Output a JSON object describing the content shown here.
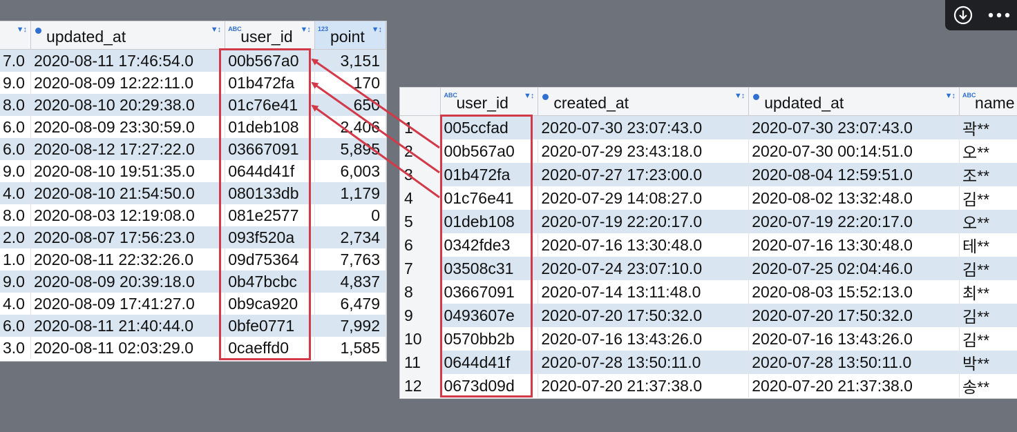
{
  "toolbar": {
    "download_icon": "download-circle-icon",
    "more_icon": "ellipsis-icon"
  },
  "left_grid": {
    "columns": [
      {
        "label": "",
        "type_badge": "",
        "filter": "▼↕"
      },
      {
        "label": "updated_at",
        "type_badge": "●",
        "filter": "▼↕"
      },
      {
        "label": "user_id",
        "type_badge": "ABC",
        "filter": "▼↕"
      },
      {
        "label": "point",
        "type_badge": "123",
        "filter": "▼↕"
      }
    ],
    "rows": [
      {
        "frag": "7.0",
        "updated_at": "2020-08-11 17:46:54.0",
        "user_id": "00b567a0",
        "point": "3,151"
      },
      {
        "frag": "9.0",
        "updated_at": "2020-08-09 12:22:11.0",
        "user_id": "01b472fa",
        "point": "170"
      },
      {
        "frag": "8.0",
        "updated_at": "2020-08-10 20:29:38.0",
        "user_id": "01c76e41",
        "point": "650"
      },
      {
        "frag": "6.0",
        "updated_at": "2020-08-09 23:30:59.0",
        "user_id": "01deb108",
        "point": "2,406"
      },
      {
        "frag": "6.0",
        "updated_at": "2020-08-12 17:27:22.0",
        "user_id": "03667091",
        "point": "5,895"
      },
      {
        "frag": "9.0",
        "updated_at": "2020-08-10 19:51:35.0",
        "user_id": "0644d41f",
        "point": "6,003"
      },
      {
        "frag": "4.0",
        "updated_at": "2020-08-10 21:54:50.0",
        "user_id": "080133db",
        "point": "1,179"
      },
      {
        "frag": "8.0",
        "updated_at": "2020-08-03 12:19:08.0",
        "user_id": "081e2577",
        "point": "0"
      },
      {
        "frag": "2.0",
        "updated_at": "2020-08-07 17:56:23.0",
        "user_id": "093f520a",
        "point": "2,734"
      },
      {
        "frag": "1.0",
        "updated_at": "2020-08-11 22:32:26.0",
        "user_id": "09d75364",
        "point": "7,763"
      },
      {
        "frag": "9.0",
        "updated_at": "2020-08-09 20:39:18.0",
        "user_id": "0b47bcbc",
        "point": "4,837"
      },
      {
        "frag": "4.0",
        "updated_at": "2020-08-09 17:41:27.0",
        "user_id": "0b9ca920",
        "point": "6,479"
      },
      {
        "frag": "6.0",
        "updated_at": "2020-08-11 21:40:44.0",
        "user_id": "0bfe0771",
        "point": "7,992"
      },
      {
        "frag": "3.0",
        "updated_at": "2020-08-11 02:03:29.0",
        "user_id": "0caeffd0",
        "point": "1,585"
      }
    ]
  },
  "right_grid": {
    "columns": [
      {
        "label": "",
        "type_badge": "",
        "filter": ""
      },
      {
        "label": "user_id",
        "type_badge": "ABC",
        "filter": "▼↕"
      },
      {
        "label": "created_at",
        "type_badge": "●",
        "filter": "▼↕"
      },
      {
        "label": "updated_at",
        "type_badge": "●",
        "filter": "▼↕"
      },
      {
        "label": "name",
        "type_badge": "ABC",
        "filter": ""
      }
    ],
    "rows": [
      {
        "n": "1",
        "user_id": "005ccfad",
        "created_at": "2020-07-30 23:07:43.0",
        "updated_at": "2020-07-30 23:07:43.0",
        "name": "곽**"
      },
      {
        "n": "2",
        "user_id": "00b567a0",
        "created_at": "2020-07-29 23:43:18.0",
        "updated_at": "2020-07-30 00:14:51.0",
        "name": "오**"
      },
      {
        "n": "3",
        "user_id": "01b472fa",
        "created_at": "2020-07-27 17:23:00.0",
        "updated_at": "2020-08-04 12:59:51.0",
        "name": "조**"
      },
      {
        "n": "4",
        "user_id": "01c76e41",
        "created_at": "2020-07-29 14:08:27.0",
        "updated_at": "2020-08-02 13:32:48.0",
        "name": "김**"
      },
      {
        "n": "5",
        "user_id": "01deb108",
        "created_at": "2020-07-19 22:20:17.0",
        "updated_at": "2020-07-19 22:20:17.0",
        "name": "오**"
      },
      {
        "n": "6",
        "user_id": "0342fde3",
        "created_at": "2020-07-16 13:30:48.0",
        "updated_at": "2020-07-16 13:30:48.0",
        "name": "테**"
      },
      {
        "n": "7",
        "user_id": "03508c31",
        "created_at": "2020-07-24 23:07:10.0",
        "updated_at": "2020-07-25 02:04:46.0",
        "name": "김**"
      },
      {
        "n": "8",
        "user_id": "03667091",
        "created_at": "2020-07-14 13:11:48.0",
        "updated_at": "2020-08-03 15:52:13.0",
        "name": "최**"
      },
      {
        "n": "9",
        "user_id": "0493607e",
        "created_at": "2020-07-20 17:50:32.0",
        "updated_at": "2020-07-20 17:50:32.0",
        "name": "김**"
      },
      {
        "n": "10",
        "user_id": "0570bb2b",
        "created_at": "2020-07-16 13:43:26.0",
        "updated_at": "2020-07-16 13:43:26.0",
        "name": "김**"
      },
      {
        "n": "11",
        "user_id": "0644d41f",
        "created_at": "2020-07-28 13:50:11.0",
        "updated_at": "2020-07-28 13:50:11.0",
        "name": "박**"
      },
      {
        "n": "12",
        "user_id": "0673d09d",
        "created_at": "2020-07-20 21:37:38.0",
        "updated_at": "2020-07-20 21:37:38.0",
        "name": "송**"
      }
    ]
  },
  "colors": {
    "highlight": "#d23a4a",
    "row_alt": "#d9e5f1",
    "header_selected": "#d3e4f7",
    "icon": "#2f6fd0"
  }
}
